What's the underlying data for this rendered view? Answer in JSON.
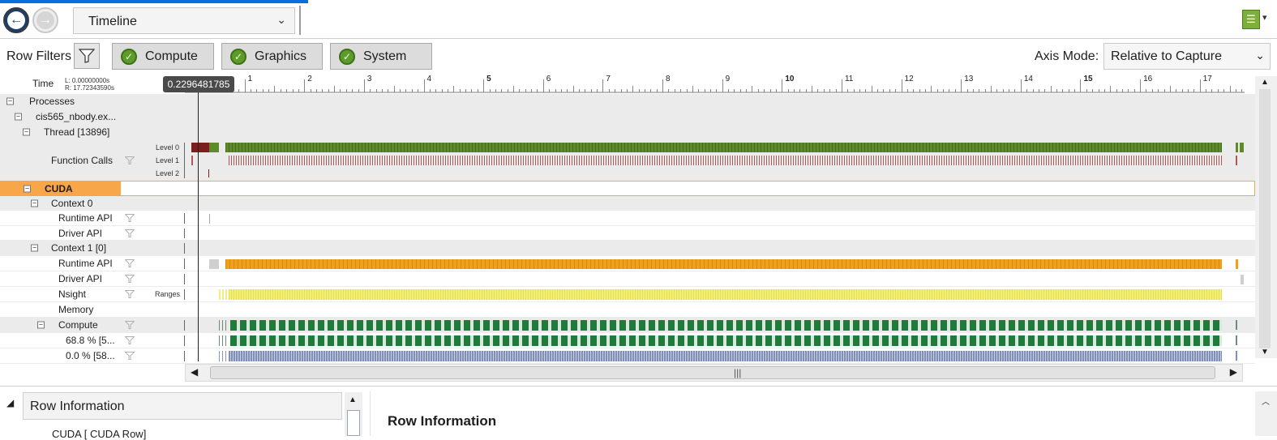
{
  "toolbar": {
    "view_selector_value": "Timeline",
    "back_icon": "back-arrow-icon",
    "forward_icon": "forward-arrow-icon",
    "document_icon": "document-icon"
  },
  "filters": {
    "row_filters_label": "Row Filters",
    "toggles": [
      "Compute",
      "Graphics",
      "System"
    ],
    "axis_mode_label": "Axis Mode:",
    "axis_mode_value": "Relative to Capture"
  },
  "timeline": {
    "time_label": "Time",
    "left_time": "L: 0.00000000s",
    "right_time": "R: 17.72343590s",
    "cursor_value": "0.2296481785",
    "axis_range": [
      0,
      17.7234359
    ],
    "tick_labels": [
      "1",
      "2",
      "3",
      "4",
      "5",
      "6",
      "7",
      "8",
      "9",
      "10",
      "11",
      "12",
      "13",
      "14",
      "15",
      "16",
      "17"
    ]
  },
  "rows": [
    {
      "label": "Processes",
      "style": "gray",
      "expander": "⊟"
    },
    {
      "label": "cis565_nbody.ex...",
      "style": "gray",
      "expander": "⊟"
    },
    {
      "label": "Thread [13896]",
      "style": "gray",
      "expander": "⊟"
    },
    {
      "label": "Function Calls",
      "style": "gray",
      "levels": [
        "Level 0",
        "Level 1",
        "Level 2"
      ]
    },
    {
      "label": "CUDA",
      "style": "cuda",
      "expander": "⊟"
    },
    {
      "label": "Context 0",
      "style": "gray",
      "expander": "⊟"
    },
    {
      "label": "Runtime API",
      "style": "white"
    },
    {
      "label": "Driver API",
      "style": "white"
    },
    {
      "label": "Context 1 [0]",
      "style": "gray",
      "expander": "⊟"
    },
    {
      "label": "Runtime API",
      "style": "white"
    },
    {
      "label": "Driver API",
      "style": "white"
    },
    {
      "label": "Nsight",
      "style": "white",
      "sub": "Ranges"
    },
    {
      "label": "Memory",
      "style": "white"
    },
    {
      "label": "Compute",
      "style": "gray",
      "expander": "⊟"
    },
    {
      "label": "68.8 % [5...",
      "style": "white"
    },
    {
      "label": "0.0 % [58...",
      "style": "white"
    }
  ],
  "colors": {
    "green": "#5e8a2c",
    "dark_red": "#7a1e1e",
    "rose": "#a85a5a",
    "orange": "#f0a11c",
    "yellow": "#f2ee7a",
    "dark_green": "#1f7a3c",
    "blue_gray": "#7f8fb5",
    "cuda_highlight": "#f7a64a"
  },
  "bottom": {
    "row_info_tab": "Row Information",
    "row_info_sub": "CUDA [ CUDA Row]",
    "row_info_heading": "Row Information"
  }
}
